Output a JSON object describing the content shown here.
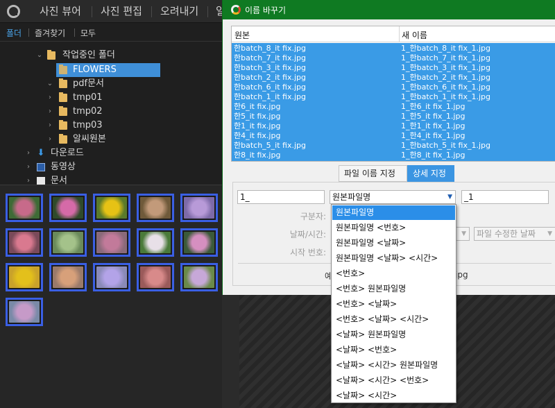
{
  "topbar": {
    "menus": [
      "사진 뷰어",
      "사진 편집",
      "오려내기",
      "일"
    ]
  },
  "left": {
    "subtabs": [
      "폴더",
      "즐겨찾기",
      "모두"
    ],
    "tree": [
      {
        "label": "작업중인 폴더"
      },
      {
        "label": "FLOWERS"
      },
      {
        "label": "pdf문서"
      },
      {
        "label": "tmp01"
      },
      {
        "label": "tmp02"
      },
      {
        "label": "tmp03"
      },
      {
        "label": "알씨원본"
      },
      {
        "label": "다운로드"
      },
      {
        "label": "동영상"
      },
      {
        "label": "문서"
      }
    ],
    "thumbnail_colors": [
      [
        "#c76a8a",
        "#3e6b36"
      ],
      [
        "#d56aa8",
        "#2f4a2a"
      ],
      [
        "#e6c215",
        "#5a7a2a"
      ],
      [
        "#c29a7a",
        "#6f5a3a"
      ],
      [
        "#b89ad8",
        "#7d6aa8"
      ],
      [
        "#d9798f",
        "#7a4a5a"
      ],
      [
        "#a4c28a",
        "#6a8a5a"
      ],
      [
        "#c27a9a",
        "#8a6a7a"
      ],
      [
        "#e8e0e8",
        "#4a7a3a"
      ],
      [
        "#d68fc0",
        "#3b5a3a"
      ],
      [
        "#e3c01b",
        "#c9a22a"
      ],
      [
        "#d7a07a",
        "#9a7a6a"
      ],
      [
        "#b3a3e8",
        "#8a8ab8"
      ],
      [
        "#d88a8a",
        "#9a5a5a"
      ],
      [
        "#c7a8d8",
        "#6a8a4a"
      ],
      [
        "#c69ac8",
        "#7a8aa8"
      ]
    ]
  },
  "dialog": {
    "title": "이름 바꾸기",
    "columns": [
      "원본",
      "새 이름"
    ],
    "rows": [
      [
        "한batch_8_it fix.jpg",
        "1_한batch_8_it fix_1.jpg"
      ],
      [
        "한batch_7_it fix.jpg",
        "1_한batch_7_it fix_1.jpg"
      ],
      [
        "한batch_3_it fix.jpg",
        "1_한batch_3_it fix_1.jpg"
      ],
      [
        "한batch_2_it fix.jpg",
        "1_한batch_2_it fix_1.jpg"
      ],
      [
        "한batch_6_it fix.jpg",
        "1_한batch_6_it fix_1.jpg"
      ],
      [
        "한batch_1_it fix.jpg",
        "1_한batch_1_it fix_1.jpg"
      ],
      [
        "한6_it fix.jpg",
        "1_한6_it fix_1.jpg"
      ],
      [
        "한5_it fix.jpg",
        "1_한5_it fix_1.jpg"
      ],
      [
        "한1_it fix.jpg",
        "1_한1_it fix_1.jpg"
      ],
      [
        "한4_it fix.jpg",
        "1_한4_it fix_1.jpg"
      ],
      [
        "한batch_5_it fix.jpg",
        "1_한batch_5_it fix_1.jpg"
      ],
      [
        "한8_it fix.jpg",
        "1_한8_it fix_1.jpg"
      ]
    ],
    "tabs": [
      "파일 이름 지정",
      "상세 지정"
    ],
    "prefix_value": "1_",
    "pattern_value": "원본파일명",
    "suffix_value": "_1",
    "labels": {
      "separator": "구분자:",
      "datetime": "날짜/시간:",
      "start_number": "시작 번호:"
    },
    "date_source_value": "파일 수정한 날짜",
    "preview_left": "예",
    "preview_right": "jpg"
  },
  "dropdown": {
    "items": [
      "원본파일명",
      "원본파일명 <번호>",
      "원본파일명 <날짜>",
      "원본파일명 <날짜> <시간>",
      "<번호>",
      "<번호> 원본파일명",
      "<번호> <날짜>",
      "<번호> <날짜> <시간>",
      "<날짜> 원본파일명",
      "<날짜> <번호>",
      "<날짜> <시간> 원본파일명",
      "<날짜> <시간> <번호>",
      "<날짜> <시간>"
    ],
    "selected_index": 0
  }
}
